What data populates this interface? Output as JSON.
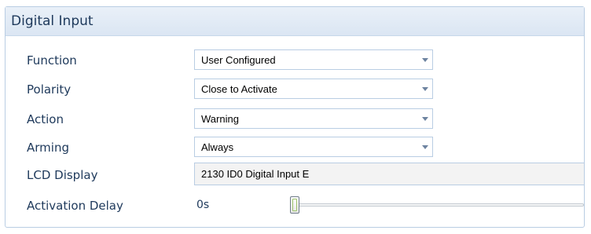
{
  "panel": {
    "title": "Digital Input"
  },
  "fields": {
    "function": {
      "label": "Function",
      "value": "User Configured"
    },
    "polarity": {
      "label": "Polarity",
      "value": "Close to Activate"
    },
    "action": {
      "label": "Action",
      "value": "Warning"
    },
    "arming": {
      "label": "Arming",
      "value": "Always"
    },
    "lcd_display": {
      "label": "LCD Display",
      "value": "2130 ID0 Digital Input E"
    },
    "activation_delay": {
      "label": "Activation Delay",
      "value": "0s",
      "slider_fraction": 0.0
    }
  },
  "colors": {
    "label_text": "#1e395b",
    "border": "#b9cde3",
    "header_bg": "#dbe6f3",
    "chevron": "#6d83a0"
  },
  "icons": {
    "dropdown": "chevron-down-icon"
  }
}
